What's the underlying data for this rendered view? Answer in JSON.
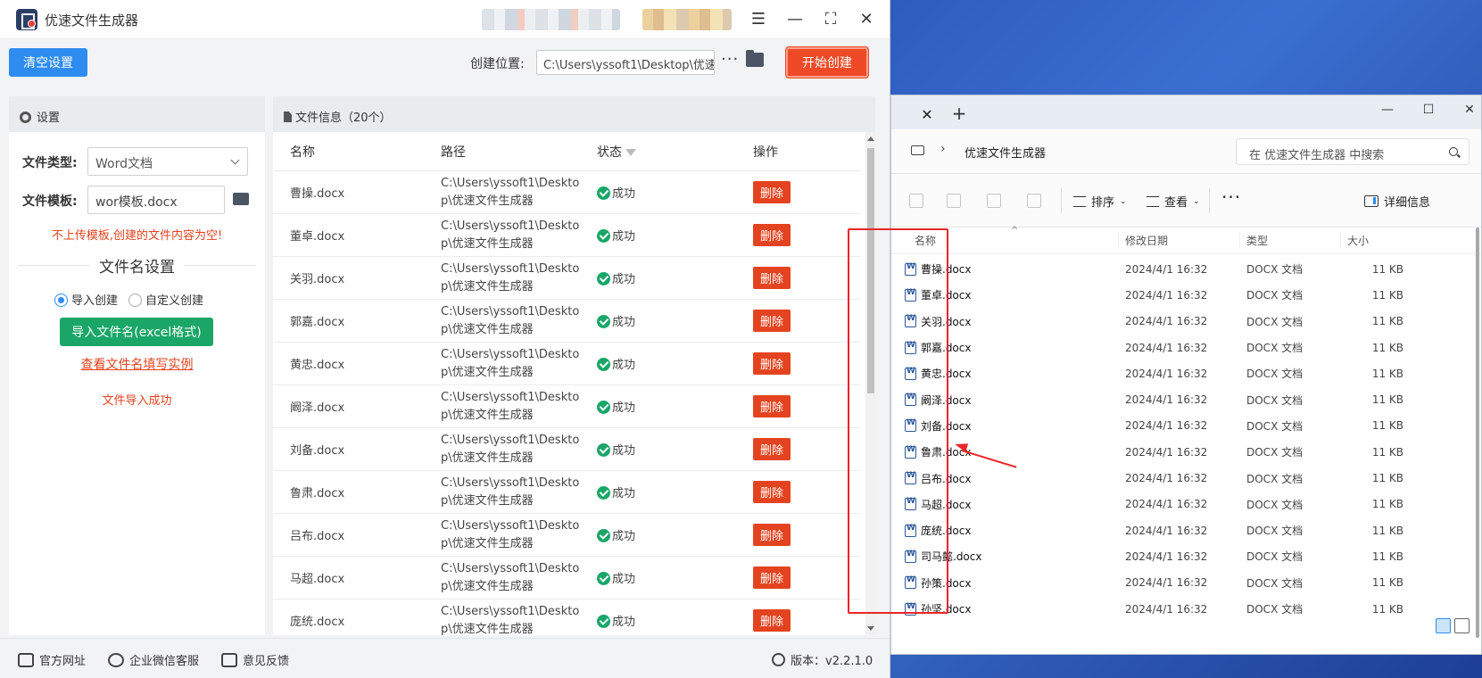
{
  "app": {
    "title": "优速文件生成器",
    "clear_button": "清空设置",
    "location_label": "创建位置:",
    "location_value": "C:\\Users\\yssoft1\\Desktop\\优速",
    "location_more": "···",
    "start_button": "开始创建",
    "settings": {
      "header": "设置",
      "file_type_label": "文件类型:",
      "file_type_value": "Word文档",
      "template_label": "文件模板:",
      "template_value": "wor模板.docx",
      "warning": "不上传模板,创建的文件内容为空!",
      "section_title": "文件名设置",
      "radio_import": "导入创建",
      "radio_custom": "自定义创建",
      "import_button": "导入文件名(excel格式)",
      "example_link": "查看文件名填写实例",
      "import_status": "文件导入成功"
    },
    "file_info": {
      "header": "文件信息（20个）",
      "columns": [
        "名称",
        "路径",
        "状态",
        "操作"
      ],
      "rows": [
        {
          "name": "曹操.docx",
          "path": "C:\\Users\\yssoft1\\Desktop\\优速文件生成器",
          "status": "成功",
          "action": "删除"
        },
        {
          "name": "董卓.docx",
          "path": "C:\\Users\\yssoft1\\Desktop\\优速文件生成器",
          "status": "成功",
          "action": "删除"
        },
        {
          "name": "关羽.docx",
          "path": "C:\\Users\\yssoft1\\Desktop\\优速文件生成器",
          "status": "成功",
          "action": "删除"
        },
        {
          "name": "郭嘉.docx",
          "path": "C:\\Users\\yssoft1\\Desktop\\优速文件生成器",
          "status": "成功",
          "action": "删除"
        },
        {
          "name": "黄忠.docx",
          "path": "C:\\Users\\yssoft1\\Desktop\\优速文件生成器",
          "status": "成功",
          "action": "删除"
        },
        {
          "name": "阚泽.docx",
          "path": "C:\\Users\\yssoft1\\Desktop\\优速文件生成器",
          "status": "成功",
          "action": "删除"
        },
        {
          "name": "刘备.docx",
          "path": "C:\\Users\\yssoft1\\Desktop\\优速文件生成器",
          "status": "成功",
          "action": "删除"
        },
        {
          "name": "鲁肃.docx",
          "path": "C:\\Users\\yssoft1\\Desktop\\优速文件生成器",
          "status": "成功",
          "action": "删除"
        },
        {
          "name": "吕布.docx",
          "path": "C:\\Users\\yssoft1\\Desktop\\优速文件生成器",
          "status": "成功",
          "action": "删除"
        },
        {
          "name": "马超.docx",
          "path": "C:\\Users\\yssoft1\\Desktop\\优速文件生成器",
          "status": "成功",
          "action": "删除"
        },
        {
          "name": "庞统.docx",
          "path": "C:\\Users\\yssoft1\\Desktop\\优速文件生成器",
          "status": "成功",
          "action": "删除"
        }
      ]
    },
    "footer": {
      "website": "官方网址",
      "wechat": "企业微信客服",
      "feedback": "意见反馈",
      "version": "版本：v2.2.1.0"
    }
  },
  "explorer": {
    "address": "优速文件生成器",
    "search_placeholder": "在 优速文件生成器 中搜索",
    "sort_label": "排序",
    "view_label": "查看",
    "details_label": "详细信息",
    "columns": [
      "名称",
      "修改日期",
      "类型",
      "大小"
    ],
    "files": [
      {
        "name": "曹操.docx",
        "date": "2024/4/1 16:32",
        "type": "DOCX 文档",
        "size": "11 KB"
      },
      {
        "name": "董卓.docx",
        "date": "2024/4/1 16:32",
        "type": "DOCX 文档",
        "size": "11 KB"
      },
      {
        "name": "关羽.docx",
        "date": "2024/4/1 16:32",
        "type": "DOCX 文档",
        "size": "11 KB"
      },
      {
        "name": "郭嘉.docx",
        "date": "2024/4/1 16:32",
        "type": "DOCX 文档",
        "size": "11 KB"
      },
      {
        "name": "黄忠.docx",
        "date": "2024/4/1 16:32",
        "type": "DOCX 文档",
        "size": "11 KB"
      },
      {
        "name": "阚泽.docx",
        "date": "2024/4/1 16:32",
        "type": "DOCX 文档",
        "size": "11 KB"
      },
      {
        "name": "刘备.docx",
        "date": "2024/4/1 16:32",
        "type": "DOCX 文档",
        "size": "11 KB"
      },
      {
        "name": "鲁肃.docx",
        "date": "2024/4/1 16:32",
        "type": "DOCX 文档",
        "size": "11 KB"
      },
      {
        "name": "吕布.docx",
        "date": "2024/4/1 16:32",
        "type": "DOCX 文档",
        "size": "11 KB"
      },
      {
        "name": "马超.docx",
        "date": "2024/4/1 16:32",
        "type": "DOCX 文档",
        "size": "11 KB"
      },
      {
        "name": "庞统.docx",
        "date": "2024/4/1 16:32",
        "type": "DOCX 文档",
        "size": "11 KB"
      },
      {
        "name": "司马懿.docx",
        "date": "2024/4/1 16:32",
        "type": "DOCX 文档",
        "size": "11 KB"
      },
      {
        "name": "孙策.docx",
        "date": "2024/4/1 16:32",
        "type": "DOCX 文档",
        "size": "11 KB"
      },
      {
        "name": "孙坚.docx",
        "date": "2024/4/1 16:32",
        "type": "DOCX 文档",
        "size": "11 KB"
      }
    ]
  },
  "colors": {
    "primary_blue": "#2e8cf0",
    "danger_red": "#e4431f",
    "success_green": "#1aa667",
    "highlight_red": "#e8262a"
  }
}
